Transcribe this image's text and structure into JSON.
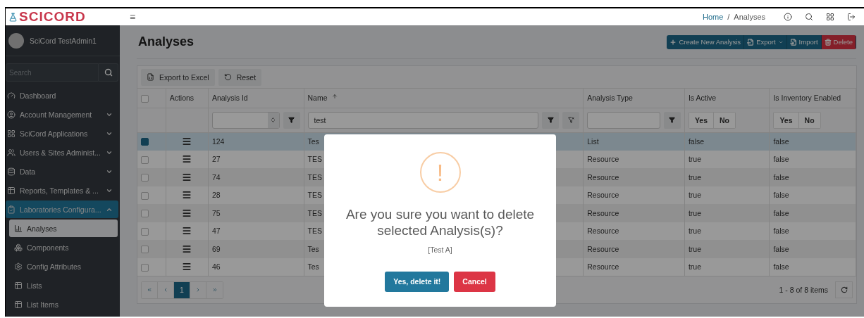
{
  "header": {
    "logo": "SCICORD",
    "menu_glyph": "≡",
    "breadcrumb": [
      {
        "label": "Home",
        "kind": "link"
      },
      {
        "label": "Analyses",
        "kind": "current"
      }
    ],
    "separator": "/"
  },
  "sidebar": {
    "user": "SciCord TestAdmin1",
    "search": {
      "placeholder": "Search"
    },
    "items": [
      {
        "label": "Dashboard",
        "selected": false
      },
      {
        "label": "Account Management",
        "selected": false,
        "expanded": false
      },
      {
        "label": "SciCord Applications",
        "selected": false,
        "expanded": false
      },
      {
        "label": "Users & Sites Administ...",
        "selected": false,
        "expanded": false
      },
      {
        "label": "Data",
        "selected": false,
        "expanded": false
      },
      {
        "label": "Reports, Templates & ...",
        "selected": false,
        "expanded": false
      },
      {
        "label": "Laboratories Configura...",
        "selected": true,
        "expanded": true,
        "children": [
          {
            "label": "Analyses",
            "selected": true
          },
          {
            "label": "Components",
            "selected": false
          },
          {
            "label": "Config Attributes",
            "selected": false
          },
          {
            "label": "Lists",
            "selected": false
          },
          {
            "label": "List Items",
            "selected": false
          }
        ]
      }
    ]
  },
  "page": {
    "title": "Analyses",
    "actions": [
      {
        "label": "Create New Analysis",
        "kind": "create"
      },
      {
        "label": "Export",
        "kind": "export"
      },
      {
        "label": "Import",
        "kind": "import"
      },
      {
        "label": "Delete",
        "kind": "delete"
      }
    ]
  },
  "grid": {
    "toolbar": [
      {
        "label": "Export to Excel",
        "kind": "excel"
      },
      {
        "label": "Reset",
        "kind": "reset"
      }
    ],
    "all_checked": false,
    "columns": [
      "Actions",
      "Analysis Id",
      "Name",
      "Analysis Type",
      "Is Active",
      "Is Inventory Enabled"
    ],
    "filters": {
      "name_value": "test",
      "bool_filters": [
        {
          "yes": "Yes",
          "no": "No"
        },
        {
          "yes": "Yes",
          "no": "No"
        }
      ]
    },
    "rows": [
      {
        "checked": true,
        "selected": true,
        "id": "124",
        "name": "Tes",
        "type": "List",
        "active": "false",
        "inventory": "false"
      },
      {
        "checked": false,
        "selected": false,
        "id": "27",
        "name": "TES",
        "type": "Resource",
        "active": "true",
        "inventory": "false"
      },
      {
        "checked": false,
        "selected": false,
        "id": "74",
        "name": "TES",
        "type": "Resource",
        "active": "true",
        "inventory": "false"
      },
      {
        "checked": false,
        "selected": false,
        "id": "28",
        "name": "TES",
        "type": "Resource",
        "active": "true",
        "inventory": "false"
      },
      {
        "checked": false,
        "selected": false,
        "id": "75",
        "name": "TES",
        "type": "Resource",
        "active": "true",
        "inventory": "false"
      },
      {
        "checked": false,
        "selected": false,
        "id": "47",
        "name": "TES",
        "type": "Resource",
        "active": "true",
        "inventory": "false"
      },
      {
        "checked": false,
        "selected": false,
        "id": "69",
        "name": "Tes",
        "type": "Resource",
        "active": "true",
        "inventory": "false"
      },
      {
        "checked": false,
        "selected": false,
        "id": "46",
        "name": "Tes",
        "type": "Resource",
        "active": "true",
        "inventory": "false"
      }
    ],
    "pager": {
      "pages": [
        {
          "label": "1",
          "selected": true
        }
      ],
      "summary": "1 - 8 of 8 items"
    }
  },
  "dialog": {
    "icon": "!",
    "title": "Are you sure you want to delete selected Analysis(s)?",
    "message": "[Test A]",
    "confirm": "Yes, delete it!",
    "cancel": "Cancel"
  }
}
